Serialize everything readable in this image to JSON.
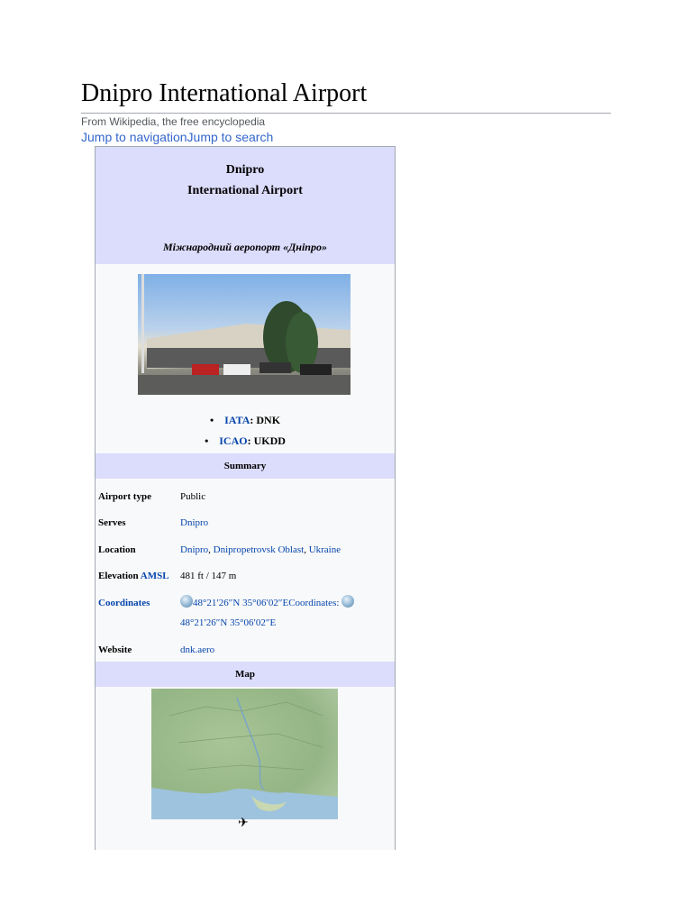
{
  "page": {
    "title": "Dnipro International Airport",
    "tagline": "From Wikipedia, the free encyclopedia",
    "jump_navigation": "Jump to navigation",
    "jump_search": "Jump to search"
  },
  "infobox": {
    "name_line1": "Dnipro",
    "name_line2": "International Airport",
    "native_name": "Міжнародний аеропорт «Дніпро»",
    "iata_label": "IATA",
    "iata_value": ": DNK",
    "icao_label": "ICAO",
    "icao_value": ": UKDD",
    "summary_header": "Summary",
    "rows": [
      {
        "key": "Airport type",
        "value": "Public"
      },
      {
        "key": "Serves",
        "value": "Dnipro"
      },
      {
        "key": "Location",
        "value_parts": [
          "Dnipro",
          ", ",
          "Dnipropetrovsk Oblast",
          ", ",
          "Ukraine"
        ]
      },
      {
        "key": "Elevation",
        "key_link": "AMSL",
        "value": "481 ft / 147 m"
      },
      {
        "key": "Coordinates",
        "value_a": "48°21′26″N 35°06′02″E",
        "value_mid": "Coordinates: ",
        "value_b": "48°21′26″N 35°06′02″E"
      },
      {
        "key": "Website",
        "value": "dnk.aero"
      }
    ],
    "map_header": "Map",
    "plane_icon": "✈"
  }
}
